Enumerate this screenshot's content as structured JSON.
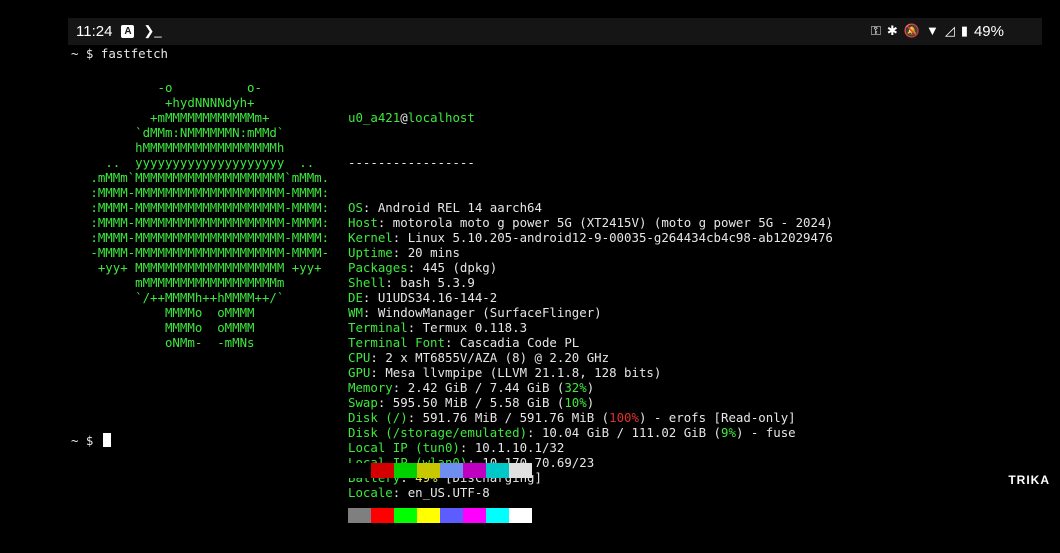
{
  "statusbar": {
    "time": "11:24",
    "app_icon_glyph": "A",
    "shell_glyph": "❯_",
    "battery": "49%",
    "icons": [
      "key-icon",
      "bluetooth-icon",
      "mute-icon",
      "wifi-icon",
      "signal-icon",
      "battery-icon"
    ]
  },
  "prompt": {
    "symbol": "~ $",
    "command": "fastfetch"
  },
  "logo_lines": [
    "            -o          o-",
    "             +hydNNNNdyh+",
    "           +mMMMMMMMMMMMMm+",
    "         `dMMm:NMMMMMMN:mMMd`",
    "         hMMMMMMMMMMMMMMMMMMh",
    "     ..  yyyyyyyyyyyyyyyyyyyy  ..",
    "   .mMMm`MMMMMMMMMMMMMMMMMMMM`mMMm.",
    "   :MMMM-MMMMMMMMMMMMMMMMMMMM-MMMM:",
    "   :MMMM-MMMMMMMMMMMMMMMMMMMM-MMMM:",
    "   :MMMM-MMMMMMMMMMMMMMMMMMMM-MMMM:",
    "   :MMMM-MMMMMMMMMMMMMMMMMMMM-MMMM:",
    "   -MMMM-MMMMMMMMMMMMMMMMMMMM-MMMM-",
    "    +yy+ MMMMMMMMMMMMMMMMMMMM +yy+",
    "         mMMMMMMMMMMMMMMMMMMm",
    "         `/++MMMMh++hMMMM++/`",
    "             MMMMo  oMMMM",
    "             MMMMo  oMMMM",
    "             oNMm-  -mMNs"
  ],
  "info": {
    "user": "u0_a421",
    "at": "@",
    "host": "localhost",
    "separator": "-----------------",
    "rows": [
      {
        "key": "OS",
        "value": "Android REL 14 aarch64"
      },
      {
        "key": "Host",
        "value": "motorola moto g power 5G (XT2415V) (moto g power 5G - 2024)"
      },
      {
        "key": "Kernel",
        "value": "Linux 5.10.205-android12-9-00035-g264434cb4c98-ab12029476"
      },
      {
        "key": "Uptime",
        "value": "20 mins"
      },
      {
        "key": "Packages",
        "value": "445 (dpkg)"
      },
      {
        "key": "Shell",
        "value": "bash 5.3.9"
      },
      {
        "key": "DE",
        "value": "U1UDS34.16-144-2"
      },
      {
        "key": "WM",
        "value": "WindowManager (SurfaceFlinger)"
      },
      {
        "key": "Terminal",
        "value": "Termux 0.118.3"
      },
      {
        "key": "Terminal Font",
        "value": "Cascadia Code PL"
      },
      {
        "key": "CPU",
        "value": "2 x MT6855V/AZA (8) @ 2.20 GHz"
      },
      {
        "key": "GPU",
        "value": "Mesa llvmpipe (LLVM 21.1.8, 128 bits)"
      },
      {
        "key": "Memory",
        "value": "2.42 GiB / 7.44 GiB (",
        "pct": "32%",
        "pct_color": "green",
        "tail": ")"
      },
      {
        "key": "Swap",
        "value": "595.50 MiB / 5.58 GiB (",
        "pct": "10%",
        "pct_color": "green",
        "tail": ")"
      },
      {
        "key": "Disk (/)",
        "value": "591.76 MiB / 591.76 MiB (",
        "pct": "100%",
        "pct_color": "red",
        "tail": ") - erofs [Read-only]"
      },
      {
        "key": "Disk (/storage/emulated)",
        "value": "10.04 GiB / 111.02 GiB (",
        "pct": "9%",
        "pct_color": "green",
        "tail": ") - fuse"
      },
      {
        "key": "Local IP (tun0)",
        "value": "10.1.10.1/32"
      },
      {
        "key": "Local IP (wlan0)",
        "value": "10.170.70.69/23"
      },
      {
        "key": "Battery",
        "value": "",
        "pct": "49%",
        "pct_color": "yellow",
        "tail": " [Discharging]"
      },
      {
        "key": "Locale",
        "value": "en_US.UTF-8"
      }
    ]
  },
  "palette": {
    "top": [
      "#000000",
      "#d40000",
      "#00d000",
      "#c8c800",
      "#6e8ef0",
      "#c000c0",
      "#00c8c8",
      "#e0e0e0"
    ],
    "bottom": [
      "#7f7f7f",
      "#ff0000",
      "#00ff00",
      "#ffff00",
      "#5c5cff",
      "#ff00ff",
      "#00ffff",
      "#ffffff"
    ]
  },
  "end_prompt": "~ $",
  "watermark": "TRIKA"
}
